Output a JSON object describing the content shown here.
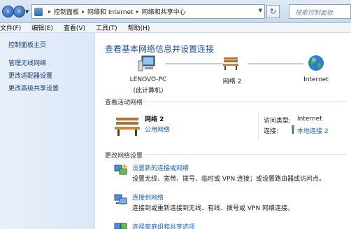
{
  "address": {
    "crumbs": [
      "控制面板",
      "网络和 Internet",
      "网络和共享中心"
    ],
    "search_placeholder": "搜索控制面板"
  },
  "menu": [
    "文件(F)",
    "编辑(E)",
    "查看(V)",
    "工具(T)",
    "帮助(H)"
  ],
  "sidebar": {
    "items": [
      "控制面板主页",
      "管理无线网络",
      "更改适配器设置",
      "更改高级共享设置"
    ]
  },
  "main": {
    "title": "查看基本网络信息并设置连接",
    "map": {
      "computer_name": "LENOVO-PC",
      "computer_sub": "(此计算机)",
      "network_name": "网络  2",
      "internet_label": "Internet"
    },
    "active": {
      "heading": "查看活动网络",
      "network_name": "网络  2",
      "network_type": "公用网络",
      "access_label": "访问类型:",
      "access_value": "Internet",
      "conn_label": "连接:",
      "conn_value": "本地连接 2"
    },
    "settings": {
      "heading": "更改网络设置",
      "tasks": [
        {
          "link": "设置新的连接或网络",
          "desc": "设置无线、宽带、拨号、临时或 VPN 连接；或设置路由器或访问点。"
        },
        {
          "link": "连接到网络",
          "desc": "连接到或重新连接到无线、有线、拨号或 VPN 网络连接。"
        },
        {
          "link": "选择家庭组和共享选项",
          "desc": ""
        }
      ]
    }
  }
}
